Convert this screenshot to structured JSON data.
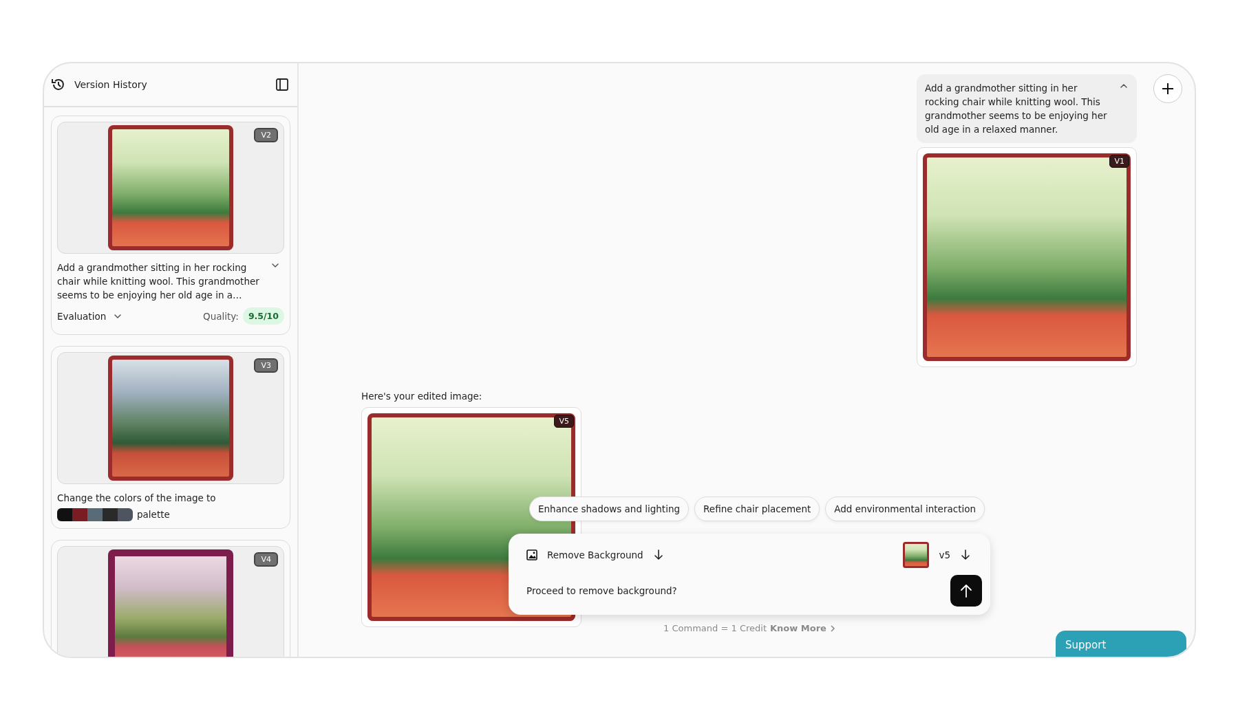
{
  "sidebar": {
    "title": "Version History",
    "versions": [
      {
        "badge": "V2",
        "prompt": "Add a grandmother sitting in her rocking chair while knitting wool. This grandmother seems to be enjoying her old age in a…",
        "expanded": false,
        "evaluation": {
          "label": "Evaluation",
          "expanded": false
        },
        "quality_label": "Quality:",
        "quality": "9.5/10"
      },
      {
        "badge": "V3",
        "prompt": "Change the colors of the image to",
        "palette": [
          {
            "color": "#111111"
          },
          {
            "color": "#7a1c24"
          },
          {
            "color": "#5a6b78"
          },
          {
            "color": "#2a2a2a"
          },
          {
            "color": "#4e5561"
          }
        ],
        "palette_suffix": "palette"
      },
      {
        "badge": "V4"
      }
    ]
  },
  "chat": {
    "prompt": {
      "text": "Add a grandmother sitting in her rocking chair while knitting wool. This grandmother seems to be enjoying her old age in a relaxed manner.",
      "expanded": true
    },
    "prompt_image_badge": "V1",
    "response": "Here's your edited image:",
    "result_badge": "V5"
  },
  "suggestions": [
    "Enhance shadows and lighting",
    "Refine chair placement",
    "Add environmental interaction"
  ],
  "command": {
    "tool": "Remove Background",
    "version": "v5",
    "message": "Proceed to remove background?"
  },
  "credit_note": "1 Command = 1 Credit",
  "know_more": "Know More",
  "support": "Support"
}
